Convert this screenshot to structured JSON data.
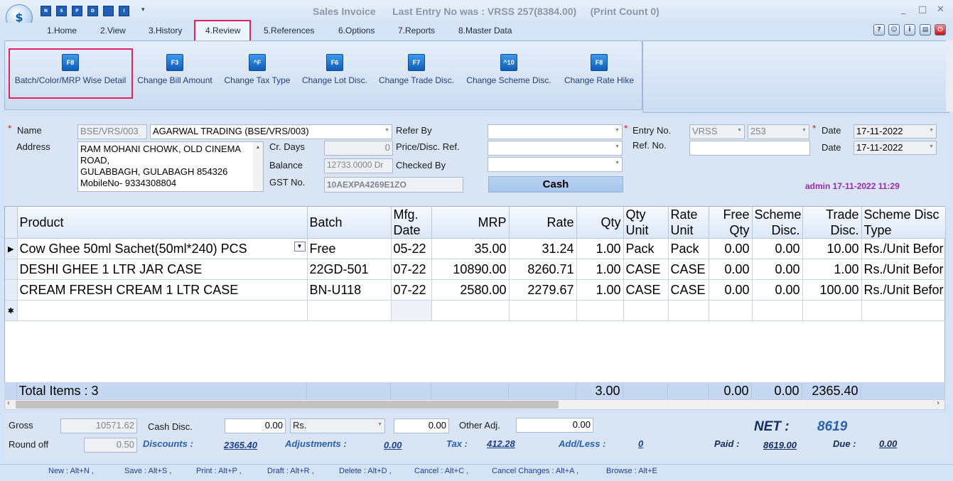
{
  "window": {
    "title": "Sales Invoice",
    "last_entry": "Last Entry No was : VRSS 257(8384.00)",
    "print_count": "(Print Count 0)",
    "min": "_",
    "max": "□",
    "close": "✕"
  },
  "quick_access": [
    "N",
    "S",
    "P",
    "D",
    "",
    "I"
  ],
  "menu": [
    "1.Home",
    "2.View",
    "3.History",
    "4.Review",
    "5.References",
    "6.Options",
    "7.Reports",
    "8.Master Data"
  ],
  "ribbon": [
    {
      "key": "F8",
      "label": "Batch/Color/MRP Wise Detail"
    },
    {
      "key": "F3",
      "label": "Change Bill Amount"
    },
    {
      "key": "^F",
      "label": "Change Tax Type"
    },
    {
      "key": "F6",
      "label": "Change Lot Disc."
    },
    {
      "key": "F7",
      "label": "Change Trade Disc."
    },
    {
      "key": "^10",
      "label": "Change Scheme Disc."
    },
    {
      "key": "F8",
      "label": "Change Rate Hike"
    }
  ],
  "form": {
    "name_label": "Name",
    "address_label": "Address",
    "party_code": "BSE/VRS/003",
    "party_name": "AGARWAL TRADING (BSE/VRS/003)",
    "address": [
      "RAM MOHANI CHOWK, OLD CINEMA",
      "ROAD,",
      "GULABBAGH, GULABAGH 854326",
      " MobileNo- 9334308804"
    ],
    "cr_days_label": "Cr. Days",
    "cr_days": "0",
    "balance_label": "Balance",
    "balance": "12733.0000 Dr",
    "gst_label": "GST No.",
    "gst": "10AEXPA4269E1ZO",
    "refer_by_label": "Refer By",
    "price_ref_label": "Price/Disc. Ref.",
    "checked_by_label": "Checked By",
    "cash_label": "Cash",
    "entry_no_label": "Entry No.",
    "entry_series": "VRSS",
    "entry_no": "253",
    "ref_no_label": "Ref. No.",
    "date_label": "Date",
    "date1": "17-11-2022",
    "date2": "17-11-2022",
    "user_stamp": "admin 17-11-2022 11:29"
  },
  "grid": {
    "columns": [
      [
        "Product",
        ""
      ],
      [
        "Batch",
        ""
      ],
      [
        "Mfg.",
        "Date"
      ],
      [
        "MRP",
        ""
      ],
      [
        "Rate",
        ""
      ],
      [
        "Qty",
        ""
      ],
      [
        "Qty",
        "Unit"
      ],
      [
        "Rate",
        "Unit"
      ],
      [
        "Free",
        "Qty"
      ],
      [
        "Scheme",
        "Disc."
      ],
      [
        "Trade",
        "Disc."
      ],
      [
        "Scheme Disc",
        "Type"
      ]
    ],
    "rows": [
      [
        "Cow Ghee 50ml Sachet(50ml*240) PCS",
        "Free",
        "05-22",
        "35.00",
        "31.24",
        "1.00",
        "Pack",
        "Pack",
        "0.00",
        "0.00",
        "10.00",
        "Rs./Unit Befor"
      ],
      [
        "DESHI GHEE 1 LTR JAR CASE",
        "22GD-501",
        "07-22",
        "10890.00",
        "8260.71",
        "1.00",
        "CASE",
        "CASE",
        "0.00",
        "0.00",
        "1.00",
        "Rs./Unit Befor"
      ],
      [
        "CREAM FRESH CREAM 1 LTR CASE",
        "BN-U118",
        "07-22",
        "2580.00",
        "2279.67",
        "1.00",
        "CASE",
        "CASE",
        "0.00",
        "0.00",
        "100.00",
        "Rs./Unit Befor"
      ]
    ],
    "totals": {
      "label": "Total Items : 3",
      "qty": "3.00",
      "free_qty": "0.00",
      "scheme": "0.00",
      "trade": "2365.40"
    }
  },
  "footer": {
    "gross_label": "Gross",
    "gross": "10571.62",
    "cash_disc_label": "Cash Disc.",
    "cash_disc": "0.00",
    "cash_disc_unit": "Rs.",
    "cash_disc_amt": "0.00",
    "other_adj_label": "Other Adj.",
    "other_adj": "0.00",
    "round_label": "Round off",
    "round": "0.50",
    "discounts_label": "Discounts :",
    "discounts": "2365.40",
    "adjustments_label": "Adjustments :",
    "adjustments": "0.00",
    "tax_label": "Tax :",
    "tax": "412.28",
    "addless_label": "Add/Less :",
    "addless": "0",
    "net_label": "NET :",
    "net": "8619",
    "paid_label": "Paid :",
    "paid": "8619.00",
    "due_label": "Due :",
    "due": "0.00"
  },
  "shortcuts": [
    "New : Alt+N ,",
    "Save : Alt+S ,",
    "Print : Alt+P ,",
    "Draft : Alt+R ,",
    "Delete : Alt+D ,",
    "Cancel : Alt+C ,",
    "Cancel Changes : Alt+A ,",
    "Browse : Alt+E"
  ]
}
